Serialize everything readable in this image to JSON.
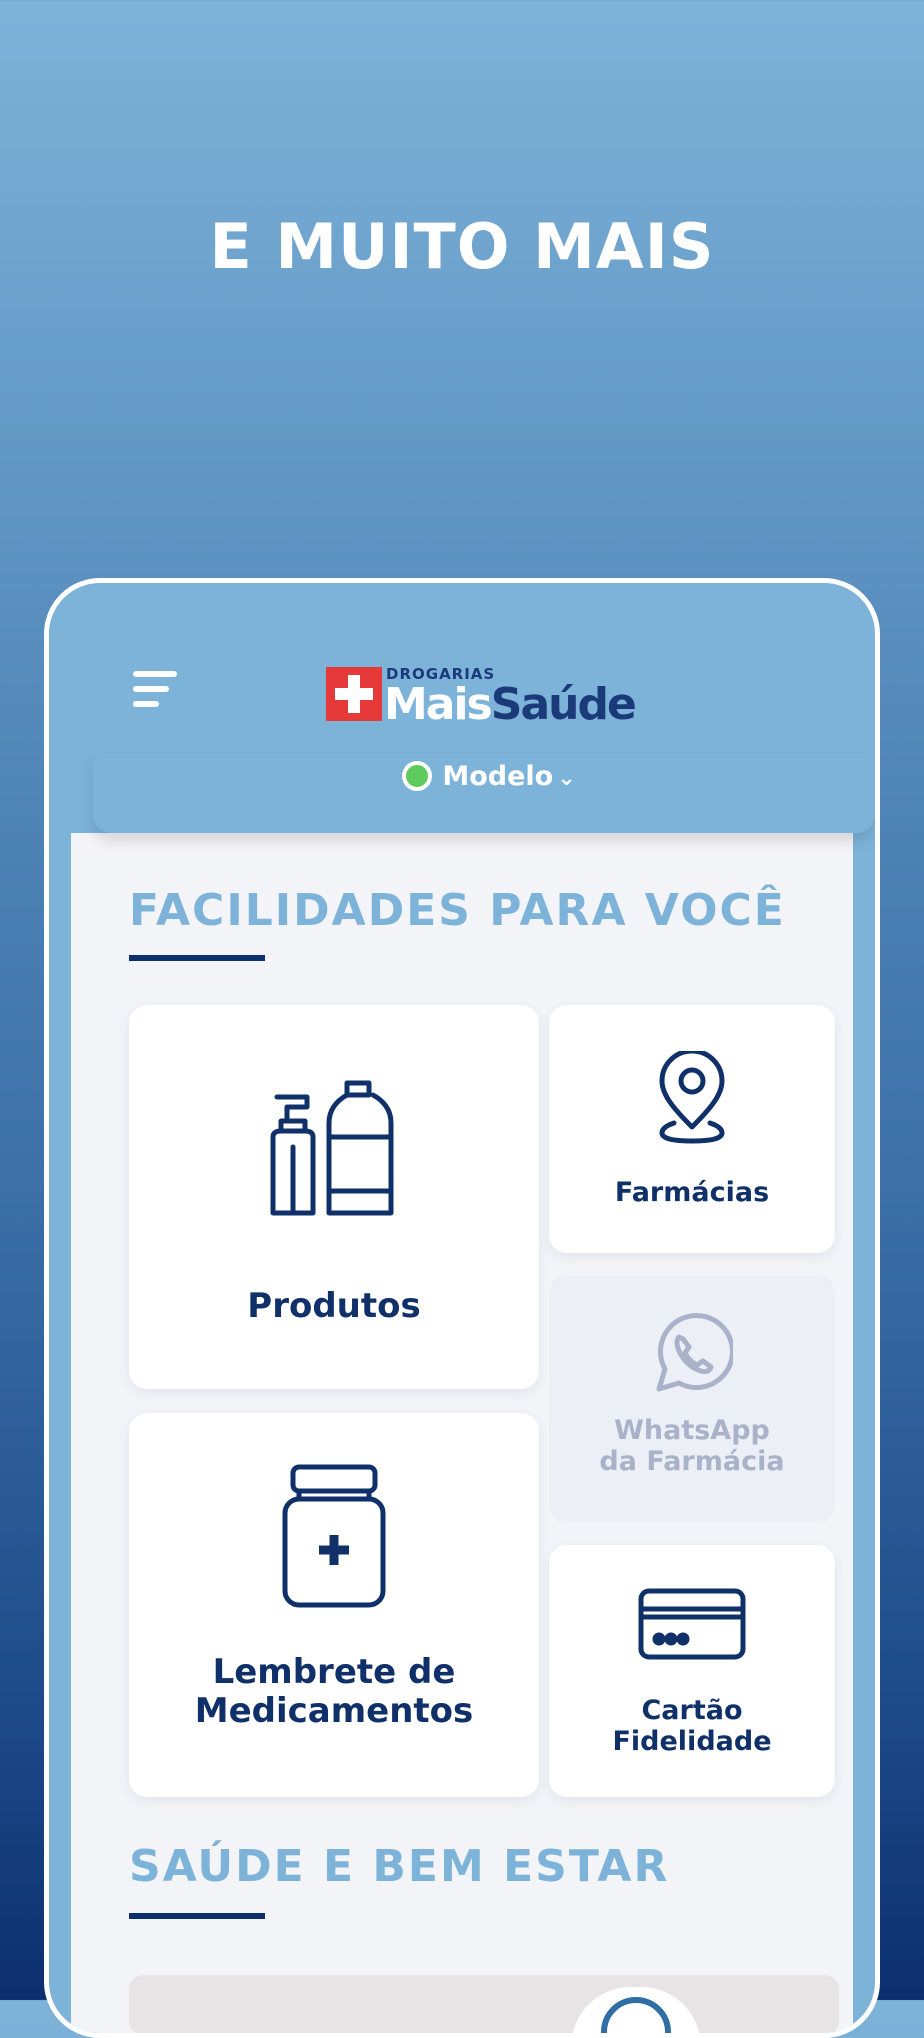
{
  "headline": "E MUITO MAIS",
  "header": {
    "logo_small": "DROGARIAS",
    "logo_mais": "Mais",
    "logo_saude": "Saúde",
    "store_name": "Modelo"
  },
  "sections": {
    "facilities_title": "FACILIDADES PARA VOCÊ",
    "wellness_title": "SAÚDE E BEM ESTAR"
  },
  "cards": {
    "produtos": "Produtos",
    "farmacias": "Farmácias",
    "whatsapp_line1": "WhatsApp",
    "whatsapp_line2": "da Farmácia",
    "lembrete_line1": "Lembrete de",
    "lembrete_line2": "Medicamentos",
    "cartao_line1": "Cartão",
    "cartao_line2": "Fidelidade"
  },
  "icons": {
    "menu": "menu-icon",
    "status": "online-dot",
    "produtos": "bottles-icon",
    "farmacias": "location-pin-icon",
    "whatsapp": "whatsapp-icon",
    "lembrete": "medicine-jar-icon",
    "cartao": "credit-card-icon"
  },
  "colors": {
    "brand_blue": "#7db3d9",
    "navy": "#10306a",
    "red_cross": "#e63939",
    "online_green": "#5ecb5e"
  }
}
